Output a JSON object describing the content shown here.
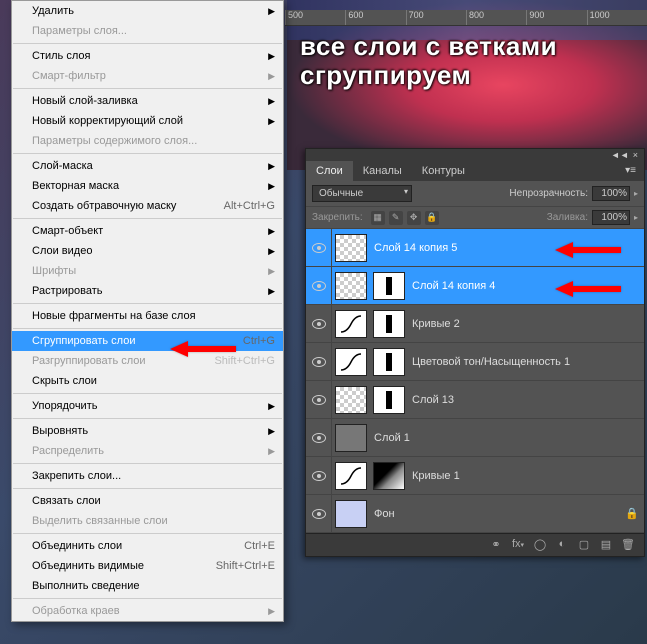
{
  "ruler_marks": [
    "500",
    "600",
    "700",
    "800",
    "900",
    "1000"
  ],
  "overlay_text_line1": "все слои с ветками",
  "overlay_text_line2": "сгруппируем",
  "menu": {
    "items": [
      {
        "label": "Удалить",
        "sub": true,
        "disabled": false
      },
      {
        "label": "Параметры слоя...",
        "disabled": true
      },
      {
        "divider": true
      },
      {
        "label": "Стиль слоя",
        "sub": true
      },
      {
        "label": "Смарт-фильтр",
        "sub": true,
        "disabled": true
      },
      {
        "divider": true
      },
      {
        "label": "Новый слой-заливка",
        "sub": true
      },
      {
        "label": "Новый корректирующий слой",
        "sub": true
      },
      {
        "label": "Параметры содержимого слоя...",
        "disabled": true
      },
      {
        "divider": true
      },
      {
        "label": "Слой-маска",
        "sub": true
      },
      {
        "label": "Векторная маска",
        "sub": true
      },
      {
        "label": "Создать обтравочную маску",
        "shortcut": "Alt+Ctrl+G"
      },
      {
        "divider": true
      },
      {
        "label": "Смарт-объект",
        "sub": true
      },
      {
        "label": "Слои видео",
        "sub": true
      },
      {
        "label": "Шрифты",
        "sub": true,
        "disabled": true
      },
      {
        "label": "Растрировать",
        "sub": true
      },
      {
        "divider": true
      },
      {
        "label": "Новые фрагменты на базе слоя"
      },
      {
        "divider": true
      },
      {
        "label": "Сгруппировать слои",
        "shortcut": "Ctrl+G",
        "highlighted": true
      },
      {
        "label": "Разгруппировать слои",
        "shortcut": "Shift+Ctrl+G",
        "disabled": true
      },
      {
        "label": "Скрыть слои"
      },
      {
        "divider": true
      },
      {
        "label": "Упорядочить",
        "sub": true
      },
      {
        "divider": true
      },
      {
        "label": "Выровнять",
        "sub": true
      },
      {
        "label": "Распределить",
        "sub": true,
        "disabled": true
      },
      {
        "divider": true
      },
      {
        "label": "Закрепить слои..."
      },
      {
        "divider": true
      },
      {
        "label": "Связать слои"
      },
      {
        "label": "Выделить связанные слои",
        "disabled": true
      },
      {
        "divider": true
      },
      {
        "label": "Объединить слои",
        "shortcut": "Ctrl+E"
      },
      {
        "label": "Объединить видимые",
        "shortcut": "Shift+Ctrl+E"
      },
      {
        "label": "Выполнить сведение"
      },
      {
        "divider": true
      },
      {
        "label": "Обработка краев",
        "sub": true,
        "disabled": true
      }
    ]
  },
  "panel": {
    "tabs": [
      "Слои",
      "Каналы",
      "Контуры"
    ],
    "active_tab": 0,
    "blend_mode": "Обычные",
    "opacity_label": "Непрозрачность:",
    "opacity_value": "100%",
    "lock_label": "Закрепить:",
    "fill_label": "Заливка:",
    "fill_value": "100%",
    "layers": [
      {
        "name": "Слой 14 копия 5",
        "selected": true,
        "thumbs": [
          "checker"
        ]
      },
      {
        "name": "Слой 14 копия 4",
        "selected": true,
        "thumbs": [
          "checker",
          "mask"
        ]
      },
      {
        "name": "Кривые 2",
        "thumbs": [
          "adjustment",
          "mask"
        ]
      },
      {
        "name": "Цветовой тон/Насыщенность 1",
        "thumbs": [
          "adjustment",
          "mask"
        ]
      },
      {
        "name": "Слой 13",
        "thumbs": [
          "checker",
          "mask"
        ]
      },
      {
        "name": "Слой 1",
        "thumbs": [
          "solid"
        ]
      },
      {
        "name": "Кривые 1",
        "thumbs": [
          "adjustment",
          "maskgrad"
        ]
      },
      {
        "name": "Фон",
        "thumbs": [
          "bg"
        ],
        "locked": true
      }
    ]
  }
}
